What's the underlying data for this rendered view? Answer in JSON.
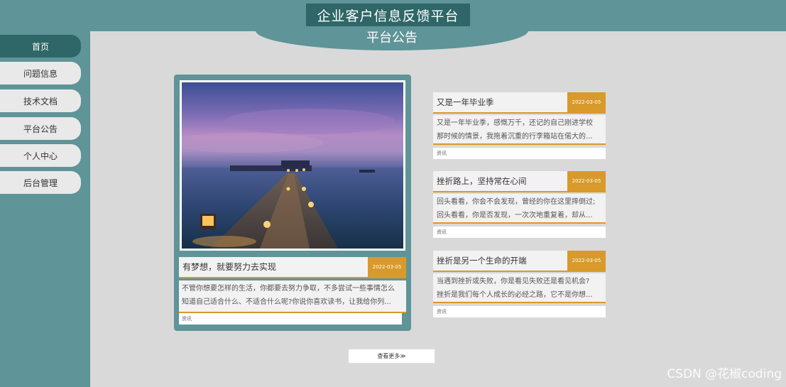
{
  "header": {
    "site_title": "企业客户信息反馈平台",
    "section_title": "平台公告"
  },
  "sidebar": {
    "items": [
      {
        "label": "首页",
        "active": true
      },
      {
        "label": "问题信息",
        "active": false
      },
      {
        "label": "技术文档",
        "active": false
      },
      {
        "label": "平台公告",
        "active": false
      },
      {
        "label": "个人中心",
        "active": false
      },
      {
        "label": "后台管理",
        "active": false
      }
    ]
  },
  "featured": {
    "title": "有梦想，就要努力去实现",
    "date": "2022-03-05",
    "desc_line1": "不管你想要怎样的生活，你都要去努力争取，不多尝试一些事情怎么",
    "desc_line2": "知道自己适合什么、不适合什么呢?你说你喜欢读书，让我给你列...",
    "category": "资讯"
  },
  "news": [
    {
      "title": "又是一年毕业季",
      "date": "2022-03-05",
      "line1": "又是一年毕业季，感慨万千，还记的自己刚进学校",
      "line2": "那时候的情景，我拖着沉重的行李箱站在偌大的...",
      "category": "资讯"
    },
    {
      "title": "挫折路上，坚持常在心间",
      "date": "2022-03-05",
      "line1": "回头看看，你会不会发现，曾经的你在这里摔倒过;",
      "line2": "回头看看，你是否发现，一次次地重复着，却从...",
      "category": "资讯"
    },
    {
      "title": "挫折是另一个生命的开端",
      "date": "2022-03-05",
      "line1": "当遇到挫折或失败，你是看见失败还是看见机会?",
      "line2": "挫折是我们每个人成长的必经之路，它不是你想...",
      "category": "资讯"
    }
  ],
  "more_button": "查看更多≫",
  "watermark": "CSDN @花椒coding",
  "colors": {
    "teal": "#5f9498",
    "dark_teal": "#2f6667",
    "accent": "#d89a2a"
  }
}
